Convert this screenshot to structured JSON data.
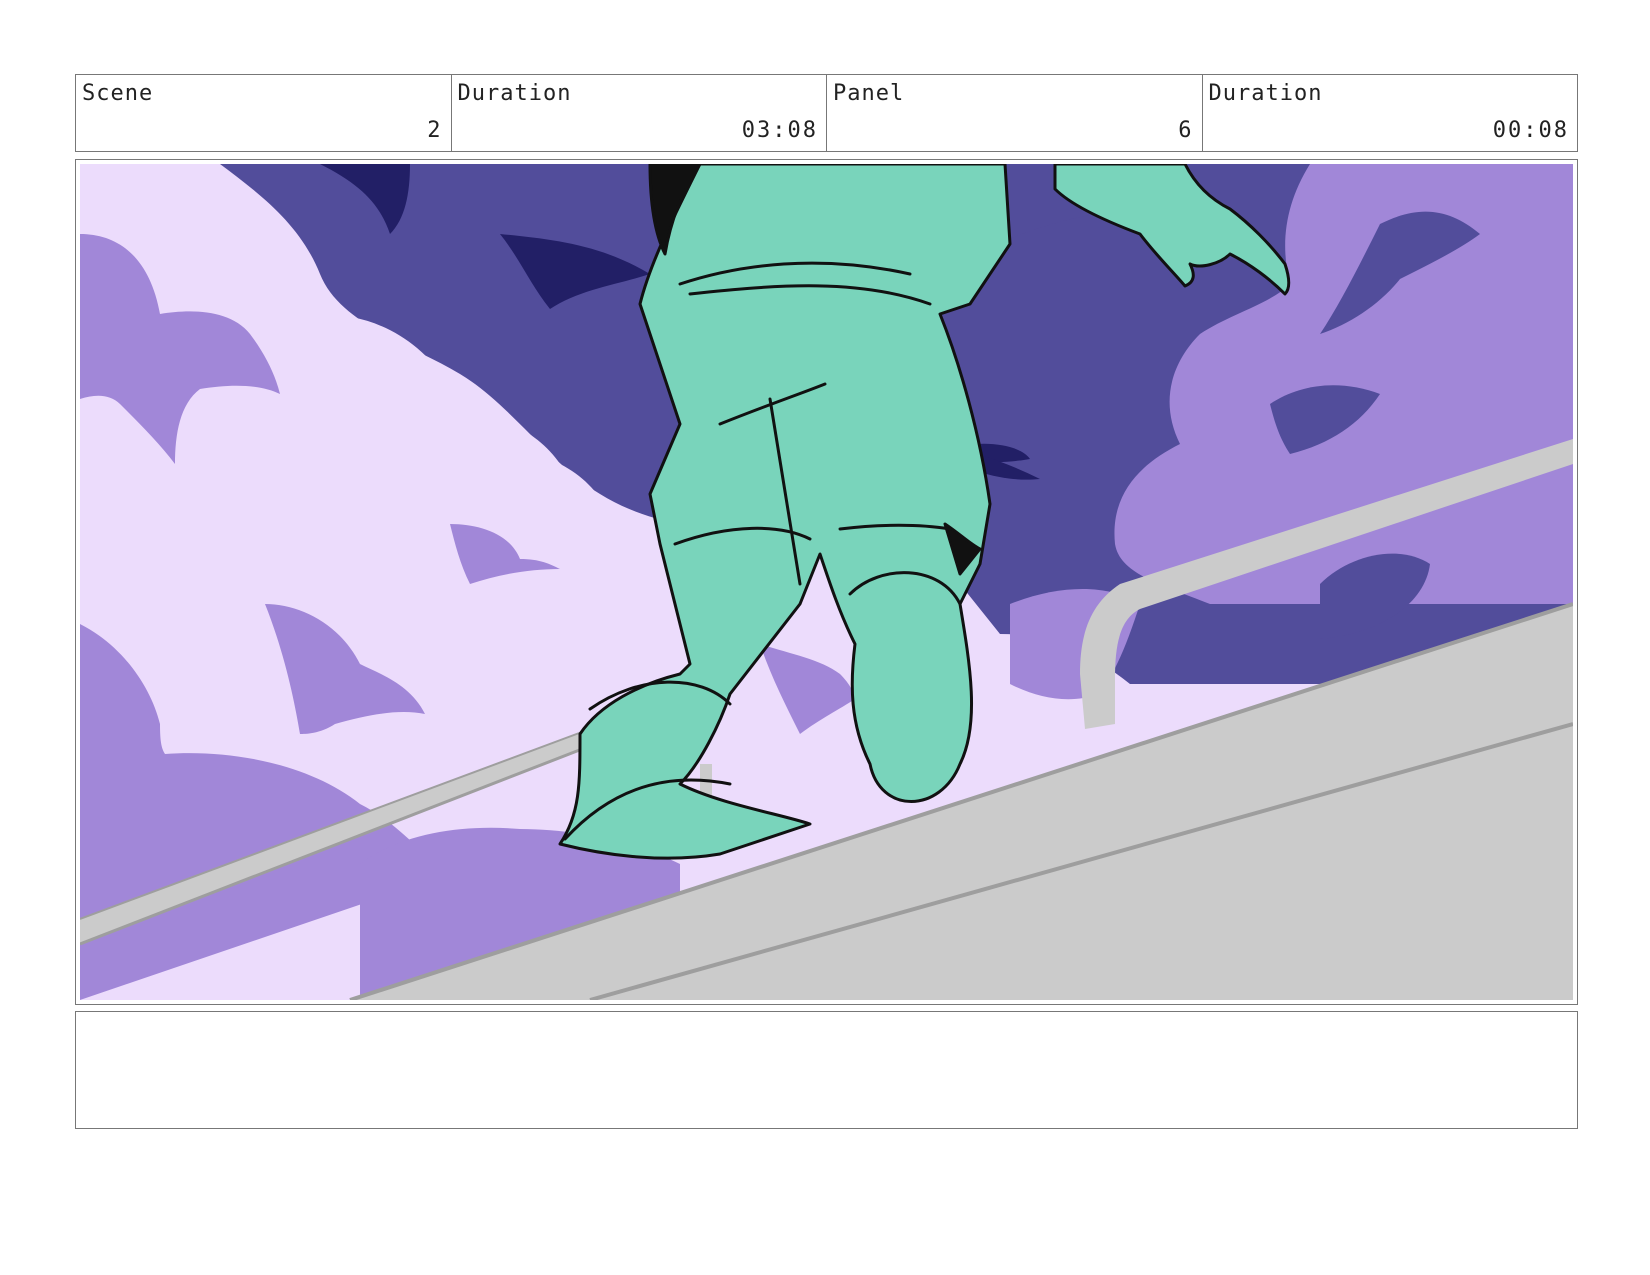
{
  "header": {
    "cells": [
      {
        "label": "Scene",
        "value": "2"
      },
      {
        "label": "Duration",
        "value": "03:08"
      },
      {
        "label": "Panel",
        "value": "6"
      },
      {
        "label": "Duration",
        "value": "00:08"
      }
    ]
  },
  "panel": {
    "colors": {
      "sky_light": "#ecdcfc",
      "cloud_mid": "#a187d8",
      "cloud_dark": "#524d9b",
      "shadow_navy": "#221f66",
      "rail_gray": "#cbcbcb",
      "rail_line": "#9e9e9e",
      "figure_teal": "#79d4bb",
      "outline": "#111111"
    }
  },
  "notes": {
    "text": ""
  }
}
